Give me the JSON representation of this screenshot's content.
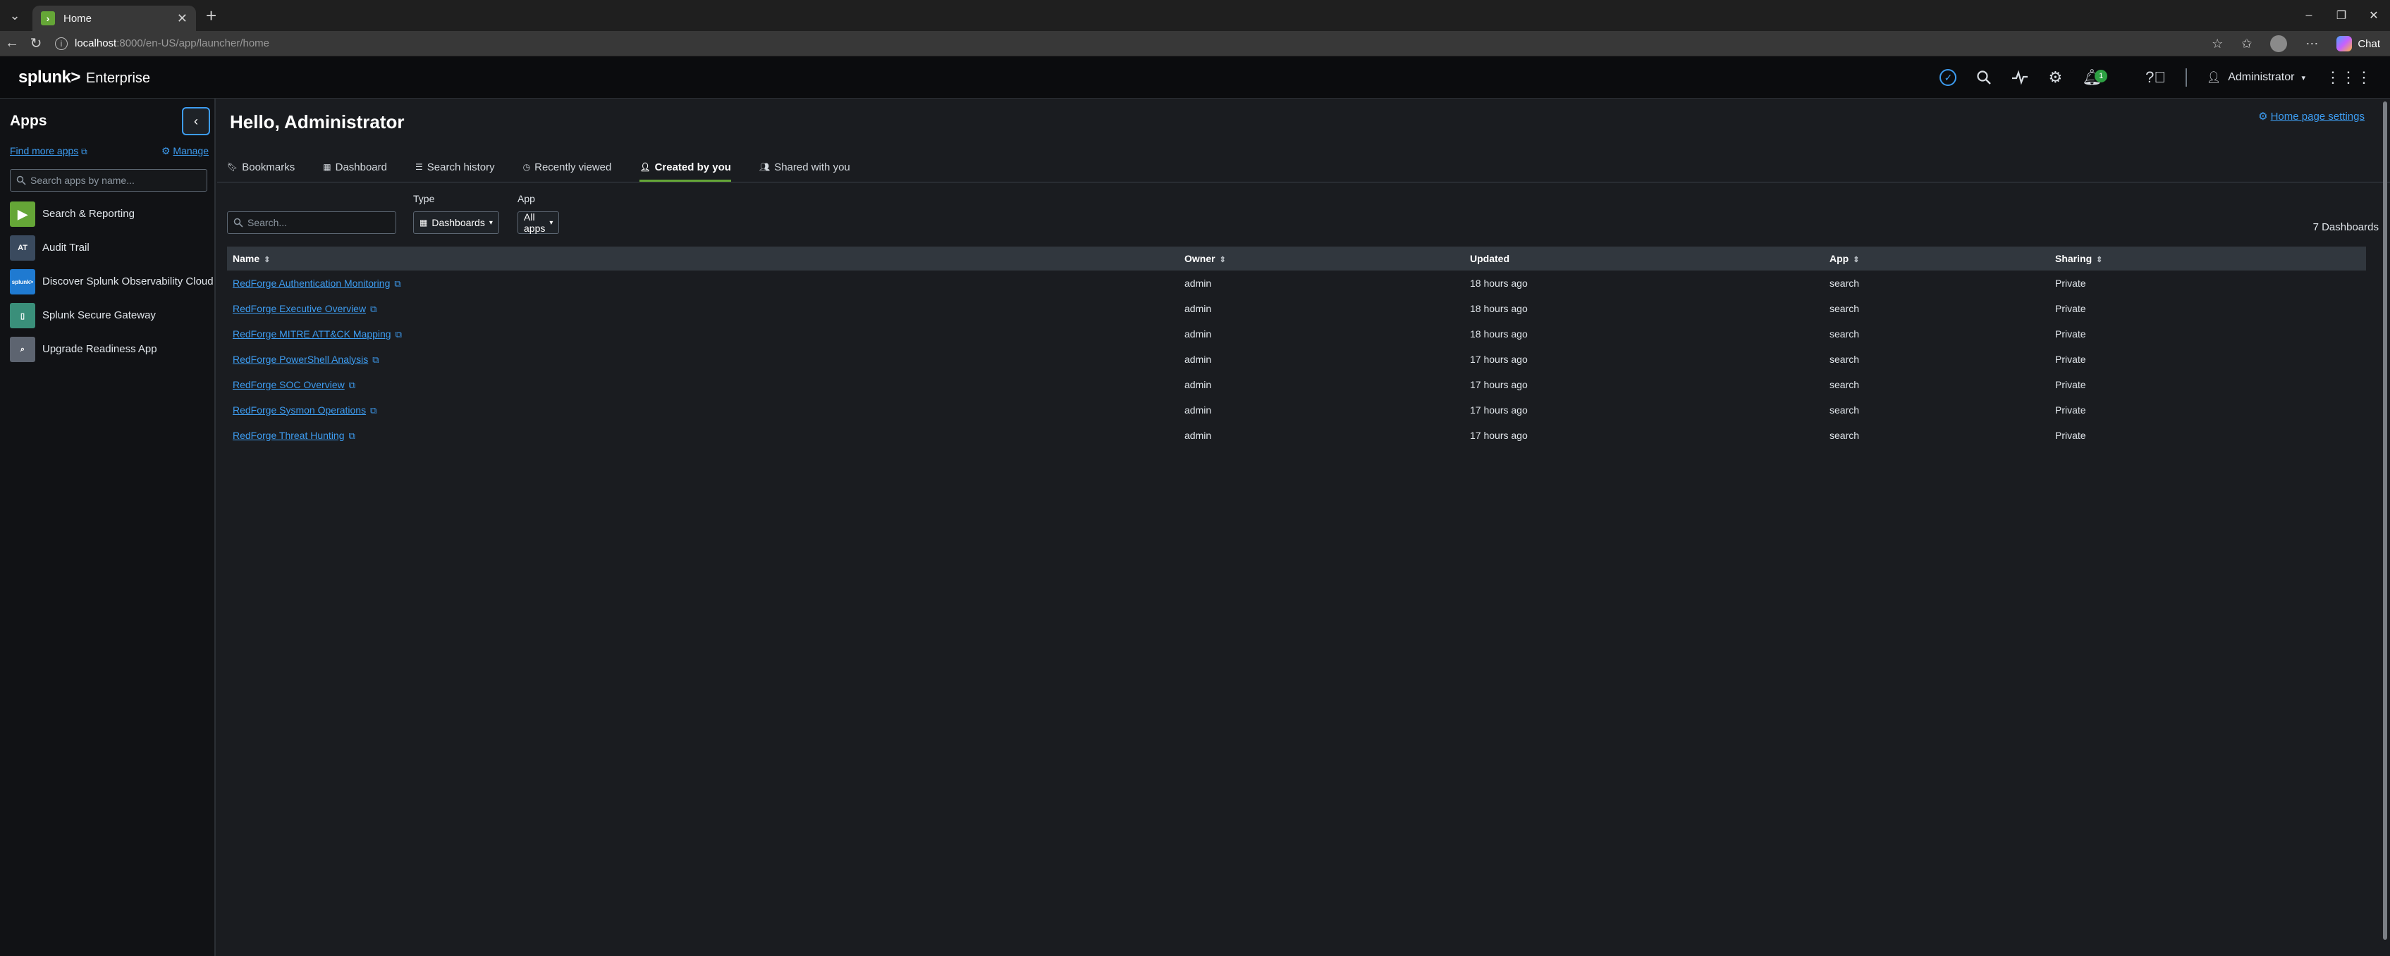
{
  "browser": {
    "tab_title": "Home",
    "url_host": "localhost",
    "url_path": ":8000/en-US/app/launcher/home",
    "chat_label": "Chat"
  },
  "header": {
    "logo_main": "splunk>",
    "logo_sub": "Enterprise",
    "user_label": "Administrator",
    "notification_count": "1"
  },
  "sidebar": {
    "title": "Apps",
    "find_more": "Find more apps",
    "manage": "Manage",
    "search_placeholder": "Search apps by name...",
    "apps": [
      {
        "label": "Search & Reporting",
        "icon_text": "▶",
        "color": "#65a637"
      },
      {
        "label": "Audit Trail",
        "icon_text": "AT",
        "color": "#3a4a5e"
      },
      {
        "label": "Discover Splunk Observability Cloud",
        "icon_text": "splunk>",
        "color": "#1f7ad1"
      },
      {
        "label": "Splunk Secure Gateway",
        "icon_text": "▯",
        "color": "#3a8f7a"
      },
      {
        "label": "Upgrade Readiness App",
        "icon_text": "⌕",
        "color": "#5d6470"
      }
    ]
  },
  "main": {
    "greeting": "Hello, Administrator",
    "home_settings": "Home page settings",
    "tabs": [
      {
        "label": "Bookmarks",
        "icon": "bookmark-icon"
      },
      {
        "label": "Dashboard",
        "icon": "dashboard-icon"
      },
      {
        "label": "Search history",
        "icon": "history-icon"
      },
      {
        "label": "Recently viewed",
        "icon": "clock-icon"
      },
      {
        "label": "Created by you",
        "icon": "user-icon"
      },
      {
        "label": "Shared with you",
        "icon": "users-icon"
      }
    ],
    "search_placeholder": "Search...",
    "type_label": "Type",
    "type_value": "Dashboards",
    "app_label": "App",
    "app_value": "All apps",
    "count_text": "7 Dashboards",
    "columns": [
      "Name",
      "Owner",
      "Updated",
      "App",
      "Sharing"
    ],
    "rows": [
      [
        "RedForge Authentication Monitoring",
        "admin",
        "18 hours ago",
        "search",
        "Private"
      ],
      [
        "RedForge Executive Overview",
        "admin",
        "18 hours ago",
        "search",
        "Private"
      ],
      [
        "RedForge MITRE ATT&CK Mapping",
        "admin",
        "18 hours ago",
        "search",
        "Private"
      ],
      [
        "RedForge PowerShell Analysis",
        "admin",
        "17 hours ago",
        "search",
        "Private"
      ],
      [
        "RedForge SOC Overview",
        "admin",
        "17 hours ago",
        "search",
        "Private"
      ],
      [
        "RedForge Sysmon Operations",
        "admin",
        "17 hours ago",
        "search",
        "Private"
      ],
      [
        "RedForge Threat Hunting",
        "admin",
        "17 hours ago",
        "search",
        "Private"
      ]
    ]
  }
}
